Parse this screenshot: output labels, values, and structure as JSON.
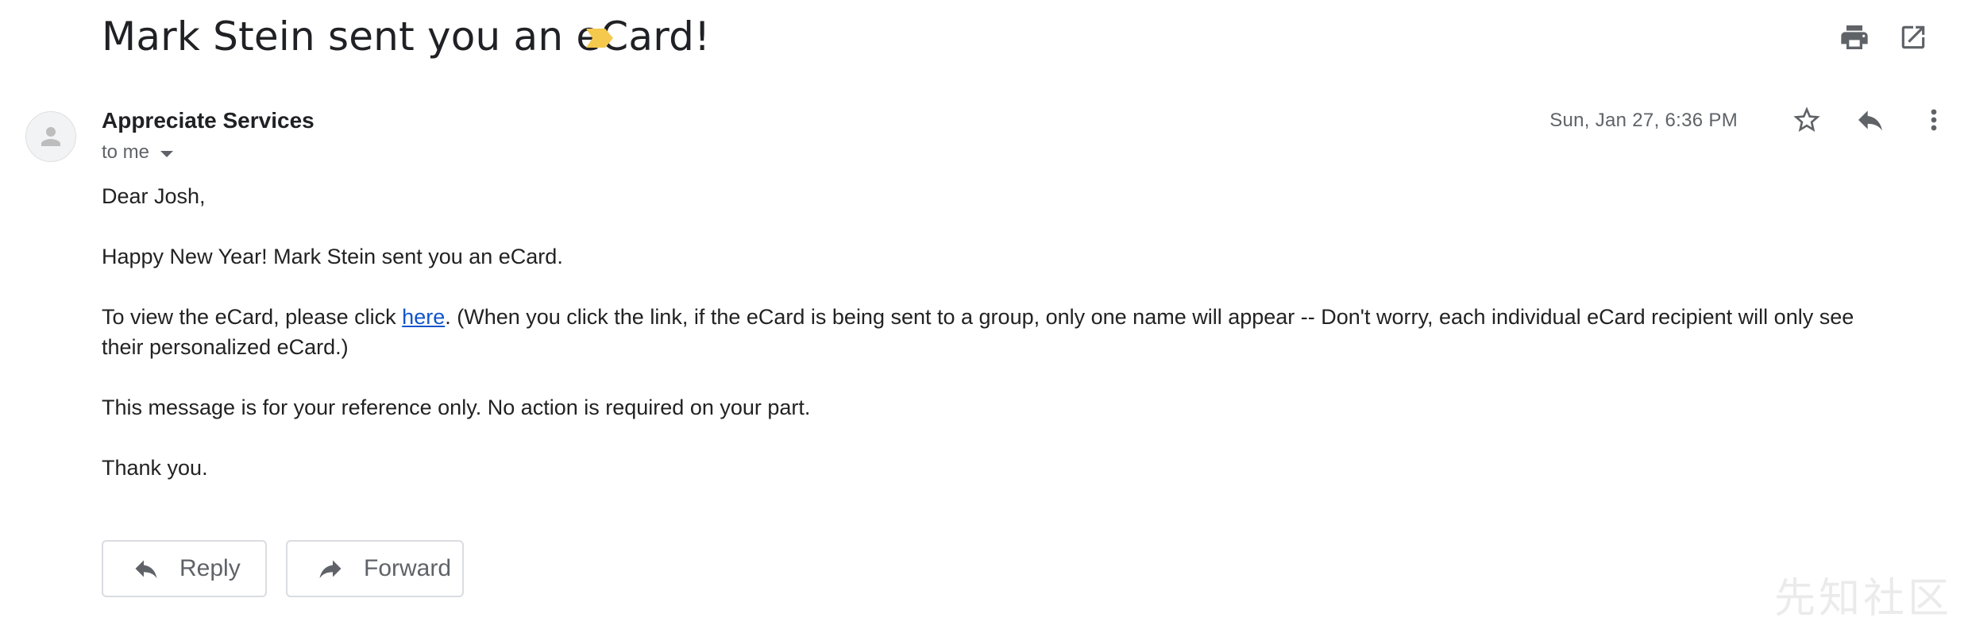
{
  "email": {
    "subject": "Mark Stein sent you an eCard!",
    "sender_name": "Appreciate Services",
    "recipient_label": "to me",
    "date": "Sun, Jan 27, 6:36 PM",
    "body": {
      "greeting": "Dear Josh,",
      "line1": "Happy New Year! Mark Stein sent you an eCard.",
      "line2_before_link": "To view the eCard, please click ",
      "link_text": "here",
      "line2_after_link": ". (When you click the link, if the eCard is being sent to a group, only one name will appear -- Don't worry, each individual eCard recipient will only see their personalized eCard.)",
      "line3": "This message is for your reference only. No action is required on your part.",
      "closing": "Thank you."
    }
  },
  "actions": {
    "reply_label": "Reply",
    "forward_label": "Forward"
  },
  "icons": {
    "label_chip": "important-marker-icon",
    "print": "print-icon",
    "open_new_window": "open-in-new-icon",
    "star": "star-icon",
    "reply": "reply-icon",
    "more": "more-vert-icon",
    "avatar": "person-icon"
  },
  "colors": {
    "important_marker": "#f4c94e",
    "link": "#1155cc",
    "secondary_text": "#5f6368"
  },
  "watermark": "先知社区"
}
